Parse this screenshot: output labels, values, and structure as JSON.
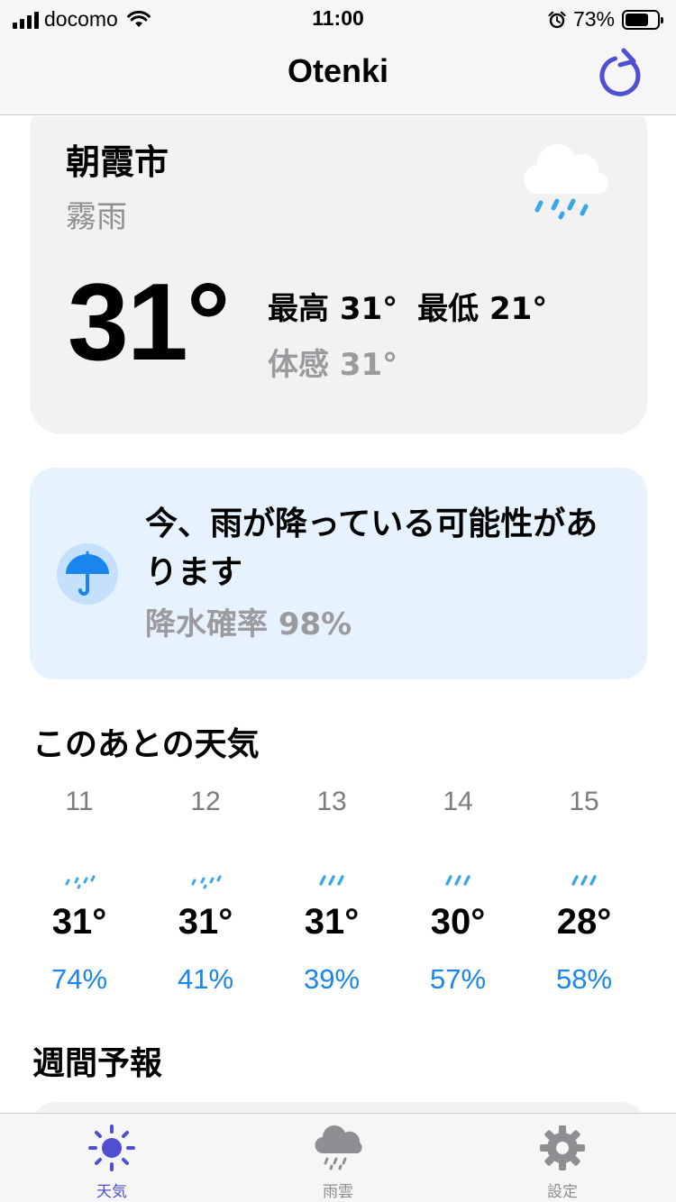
{
  "status_bar": {
    "carrier": "docomo",
    "time": "11:00",
    "battery_percent": "73%",
    "battery_level": 0.73
  },
  "nav": {
    "title": "Otenki",
    "refresh_icon": "refresh-icon"
  },
  "current": {
    "city": "朝霞市",
    "condition": "霧雨",
    "condition_icon": "cloud-drizzle-icon",
    "temperature": "31°",
    "high": "最高 31°",
    "low": "最低 21°",
    "feels_like": "体感 31°"
  },
  "rain_alert": {
    "icon": "umbrella-icon",
    "message": "今、雨が降っている可能性があります",
    "probability": "降水確率 98%"
  },
  "hourly": {
    "title": "このあとの天気",
    "hours": [
      {
        "hour": "11",
        "icon": "drizzle-icon",
        "temp": "31°",
        "pop": "74%"
      },
      {
        "hour": "12",
        "icon": "drizzle-icon",
        "temp": "31°",
        "pop": "41%"
      },
      {
        "hour": "13",
        "icon": "rain-icon",
        "temp": "31°",
        "pop": "39%"
      },
      {
        "hour": "14",
        "icon": "rain-icon",
        "temp": "30°",
        "pop": "57%"
      },
      {
        "hour": "15",
        "icon": "rain-icon",
        "temp": "28°",
        "pop": "58%"
      }
    ]
  },
  "weekly": {
    "title": "週間予報"
  },
  "tab_bar": {
    "tabs": [
      {
        "label": "天気",
        "icon": "sun-icon",
        "active": true
      },
      {
        "label": "雨雲",
        "icon": "rain-cloud-icon",
        "active": false
      },
      {
        "label": "設定",
        "icon": "gear-icon",
        "active": false
      }
    ]
  },
  "colors": {
    "accent": "#4f4fd1",
    "rain_blue": "#1a85ee",
    "drizzle_blue": "#3aa7e8",
    "card_bg": "#f2f2f2",
    "alert_bg": "#e6f2fe",
    "secondary_text": "#8e8e93"
  }
}
